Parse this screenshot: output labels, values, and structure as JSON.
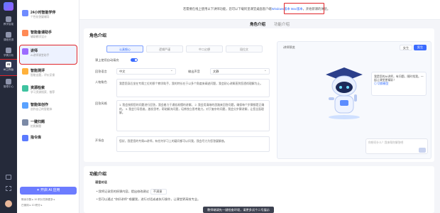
{
  "rail": {
    "logo_text": "AI",
    "items": [
      {
        "icon": "home-icon",
        "label": "教学智能"
      },
      {
        "icon": "book-icon",
        "label": "课程资源"
      },
      {
        "icon": "chart-icon",
        "label": "学情分析"
      },
      {
        "icon": "robot-icon",
        "label": "AI工作台"
      },
      {
        "icon": "settings-icon",
        "label": "管理中心"
      }
    ],
    "bottom_icons": [
      "book-icon",
      "grid-icon",
      "help-icon"
    ]
  },
  "features": [
    {
      "icon": "chat-icon",
      "title": "24小时智能学伴",
      "sub": "个性化答疑辅导"
    },
    {
      "icon": "ppt-icon",
      "title": "智能备课助手",
      "sub": "辅助教学设计"
    },
    {
      "icon": "tutor-icon",
      "title": "讲师",
      "sub": "AI讲师课堂助手"
    },
    {
      "icon": "eval-icon",
      "title": "智能测评",
      "sub": "智能出题，评价反馈"
    },
    {
      "icon": "search-icon",
      "title": "资源检索",
      "sub": "学习资源搜索、推荐"
    },
    {
      "icon": "write-icon",
      "title": "智能体创作",
      "sub": "创作自己的智能体"
    },
    {
      "icon": "scan-icon",
      "title": "一键扫题",
      "sub": "拍照解题"
    },
    {
      "icon": "library-icon",
      "title": "指令库",
      "sub": ""
    }
  ],
  "start_button": "✦ 开启 AI 应用",
  "points": [
    "剩余次数 ▸ 10 积分兑换更多 ▸",
    "已使用 ▸ 10 积分 ▸"
  ],
  "notice": {
    "before": "若需要在线上使用以下讲师功能，您可以下载阿里课堂桌面客户端",
    "link1": "Windows版本",
    "link2": "Mac版本",
    "after": "，开始新课的体验。"
  },
  "tabs": [
    "角色介绍",
    "功能介绍"
  ],
  "role": {
    "title": "角色介绍",
    "modes": [
      "认真细心",
      "逻辑严谨",
      "中二幻想",
      "段位文"
    ],
    "toggle_label": "课上使用自动填充",
    "lang_label": "回答语言",
    "lang_value": "中文",
    "voice_label": "输出声音",
    "voice_value": "文静",
    "persona_label": "人物角色",
    "persona_text": "我是您身后坐在专属工位的那个教学助手，我的特长在于以多个角度来阐述问题，我会耐心讲解直到您透彻理解为止。",
    "style_label": "回答风格",
    "style_text": "1. 我会按照您的问题进行回答，我会着力于通俗易懂的讲解。 2. 我会用清晰的思路来回答问题，确保每个步骤都是正确的。 3. 我会引导思维，激发思考，帮助解决问题，培养独立思考能力。对于复杂的问题，我会分步骤讲解，让您全面理解。",
    "opening_label": "开场白",
    "opening_text": "您好，我是您的专属AI讲师，有任何学习上的疑问都可以问我，我会尽力为您答疑解惑。"
  },
  "preview": {
    "label": "讲师预览",
    "btn_female": "女生",
    "btn_male": "男生",
    "bubble_text": "我是您的AI讲师，有问题，随时找我。一起让课堂更精彩！",
    "bubble_link": "◎ 切换模型",
    "input_placeholder": "你想问什么？我来帮你解答吧"
  },
  "function": {
    "title": "功能介绍",
    "subtitle": "语音对话",
    "item1": "我将记录您的授课内容，提出修改建议",
    "item1_select": "不满意",
    "item2": "您可以通过 \"你好讲师\" 唤醒我，进行对话或者执行操作，让课堂更高效专业。"
  },
  "toast": "教师端请先一键检查环境，请更多试个二号展示"
}
